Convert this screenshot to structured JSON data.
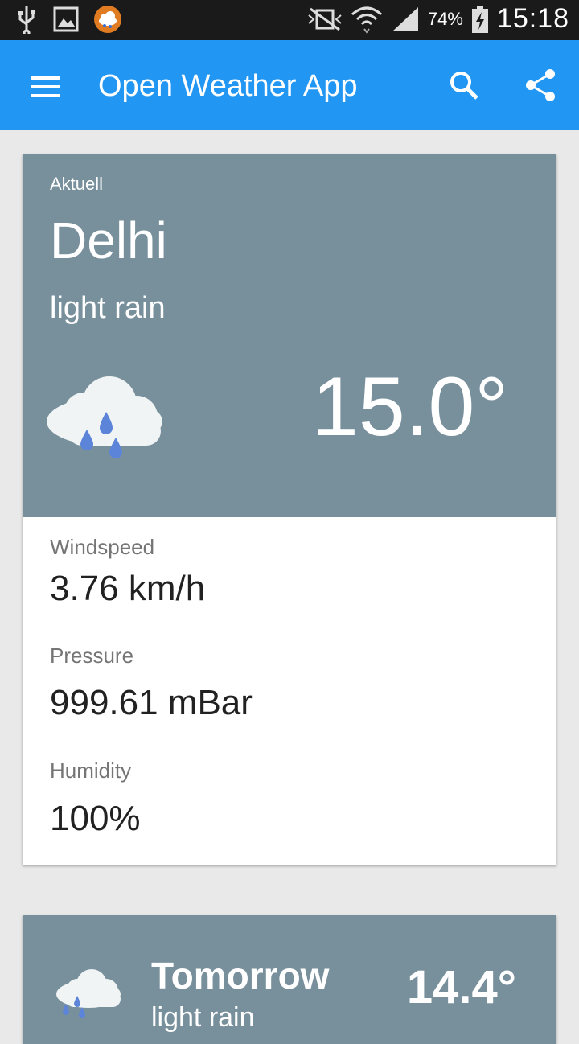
{
  "status_bar": {
    "icons": [
      "usb-icon",
      "image-icon",
      "weather-notification-icon",
      "mute-icon",
      "wifi-icon",
      "signal-icon",
      "battery-icon"
    ],
    "battery": "74%",
    "time": "15:18"
  },
  "app_bar": {
    "title": "Open Weather App",
    "icons": [
      "menu-icon",
      "search-icon",
      "share-icon"
    ],
    "color": "#2196f3"
  },
  "current": {
    "label": "Aktuell",
    "city": "Delhi",
    "description": "light rain",
    "temperature": "15.0°",
    "icon": "rain-cloud-icon",
    "card_color": "#78909c",
    "details": [
      {
        "label": "Windspeed",
        "value": "3.76 km/h"
      },
      {
        "label": "Pressure",
        "value": "999.61 mBar"
      },
      {
        "label": "Humidity",
        "value": "100%"
      }
    ]
  },
  "forecast": {
    "day": "Tomorrow",
    "description": "light rain",
    "temperature": "14.4°",
    "icon": "rain-cloud-icon"
  }
}
